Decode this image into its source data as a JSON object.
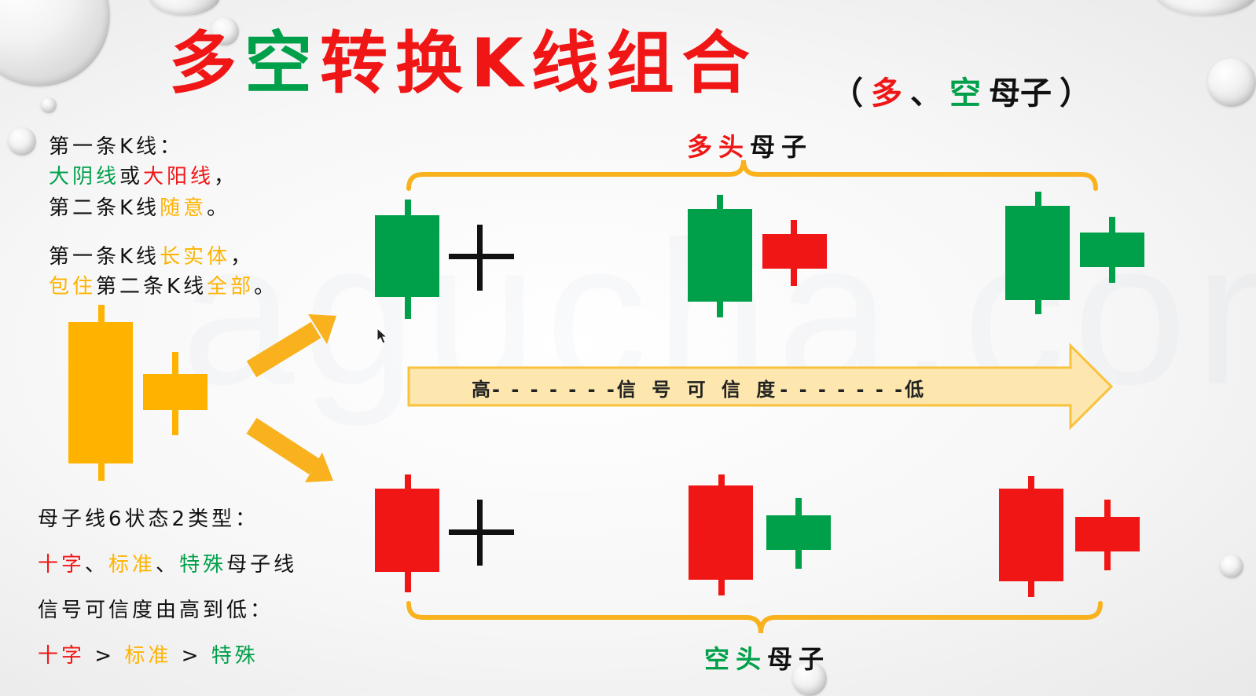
{
  "title": {
    "chars": [
      {
        "text": "多",
        "color": "#f01616"
      },
      {
        "text": "空",
        "color": "#00a04a"
      },
      {
        "text": "转",
        "color": "#f01616"
      },
      {
        "text": "换",
        "color": "#f01616"
      },
      {
        "text": "K",
        "color": "#f01616"
      },
      {
        "text": "线",
        "color": "#f01616"
      },
      {
        "text": "组",
        "color": "#f01616"
      },
      {
        "text": "合",
        "color": "#f01616"
      }
    ]
  },
  "subtitle": {
    "open": "（",
    "bull": "多",
    "sep": "、",
    "bear": "空",
    "rest": "母子",
    "close": "）"
  },
  "left_text": {
    "line1": "第一条K线：",
    "line2_a": "大阴线",
    "line2_b": "或",
    "line2_c": "大阳线",
    "line2_d": "，",
    "line3_a": "第二条K线",
    "line3_b": "随意",
    "line3_c": "。",
    "line4_a": "第一条K线",
    "line4_b": "长实体",
    "line4_c": "，",
    "line5_a": "包住",
    "line5_b": "第二条K线",
    "line5_c": "全部",
    "line5_d": "。"
  },
  "bottom_left": {
    "line1": "母子线6状态2类型：",
    "line2_a": "十字",
    "line2_b": "、",
    "line2_c": "标准",
    "line2_d": "、",
    "line2_e": "特殊",
    "line2_f": "母子线",
    "line3": "信号可信度由高到低：",
    "line4_a": "十字",
    "line4_b": " > ",
    "line4_c": "标准",
    "line4_d": " > ",
    "line4_e": "特殊"
  },
  "bull_label": {
    "a": "多头",
    "b": "母子"
  },
  "bear_label": {
    "a": "空头",
    "b": "母子"
  },
  "confidence_arrow": {
    "high": "高",
    "dashes_left": "- - - - - - -",
    "middle": "信 号 可 信 度",
    "dashes_right": "- - - - - - -",
    "low": "低"
  },
  "watermark": "agucha.com",
  "colors": {
    "red": "#f01616",
    "green": "#00a04a",
    "orange": "#ffb300",
    "black": "#111111",
    "arrow_fill": "#fde7ae",
    "arrow_stroke": "#f9c23c"
  }
}
